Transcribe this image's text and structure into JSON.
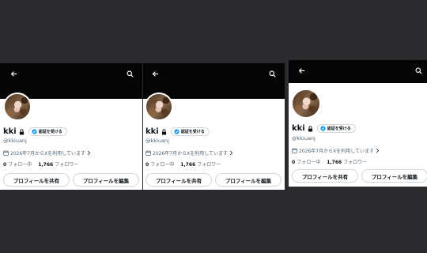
{
  "profile": {
    "name": "kki",
    "handle": "@kkiuanj",
    "verify_label": "認証を受ける",
    "joined": "2026年7月からXを利用しています",
    "following_count": "0",
    "following_label": "フォロー中",
    "followers_count": "1,766",
    "followers_label": "フォロワー",
    "share_button": "プロフィールを共有",
    "edit_button": "プロフィールを編集"
  },
  "colors": {
    "banner": "#050505",
    "page_background": "#2a2b2e",
    "verified_blue": "#1d9bf0",
    "text_primary": "#0f1419",
    "text_secondary": "#536471"
  },
  "icons": {
    "back": "back-arrow-icon",
    "search": "search-icon",
    "lock": "lock-icon",
    "verified": "verified-badge-icon",
    "calendar": "calendar-icon",
    "chevron": "chevron-right-icon"
  }
}
